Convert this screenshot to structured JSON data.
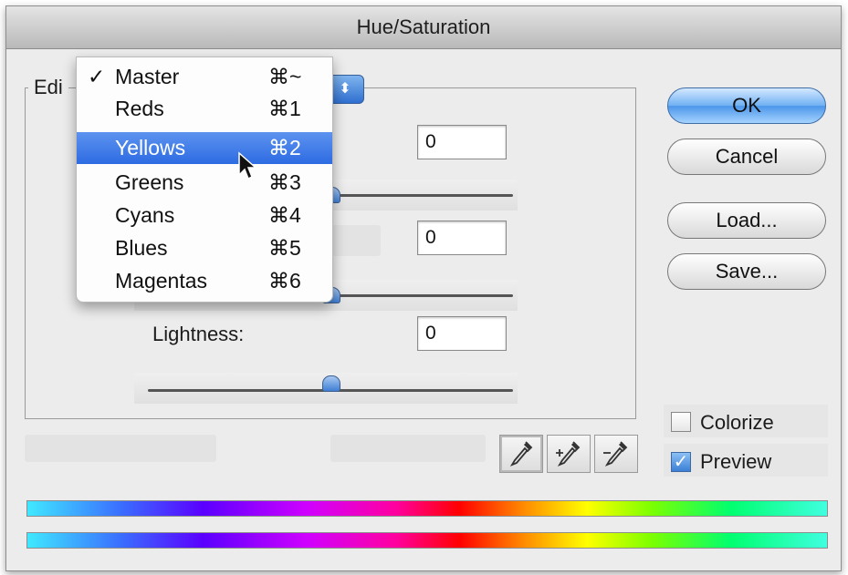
{
  "window": {
    "title": "Hue/Saturation"
  },
  "edit": {
    "label": "Edi",
    "stepper_glyph": "⬍"
  },
  "fields": {
    "hue_value": "0",
    "saturation_value": "0",
    "lightness_label": "Lightness:",
    "lightness_value": "0"
  },
  "buttons": {
    "ok": "OK",
    "cancel": "Cancel",
    "load": "Load...",
    "save": "Save..."
  },
  "checkboxes": {
    "colorize": {
      "label": "Colorize",
      "checked": false
    },
    "preview": {
      "label": "Preview",
      "checked": true,
      "mark": "✓"
    }
  },
  "dropdown_menu": {
    "items": [
      {
        "check": "✓",
        "label": "Master",
        "shortcut": "⌘~",
        "selected": false
      },
      {
        "check": "",
        "label": "Reds",
        "shortcut": "⌘1",
        "selected": false
      },
      {
        "check": "",
        "label": "Yellows",
        "shortcut": "⌘2",
        "selected": true
      },
      {
        "check": "",
        "label": "Greens",
        "shortcut": "⌘3",
        "selected": false
      },
      {
        "check": "",
        "label": "Cyans",
        "shortcut": "⌘4",
        "selected": false
      },
      {
        "check": "",
        "label": "Blues",
        "shortcut": "⌘5",
        "selected": false
      },
      {
        "check": "",
        "label": "Magentas",
        "shortcut": "⌘6",
        "selected": false
      }
    ]
  },
  "colors": {
    "accent": "#2d6be2",
    "dialog_bg": "#ececec"
  },
  "icons": [
    "eyedropper-icon",
    "eyedropper-plus-icon",
    "eyedropper-minus-icon",
    "arrow-cursor-icon"
  ]
}
